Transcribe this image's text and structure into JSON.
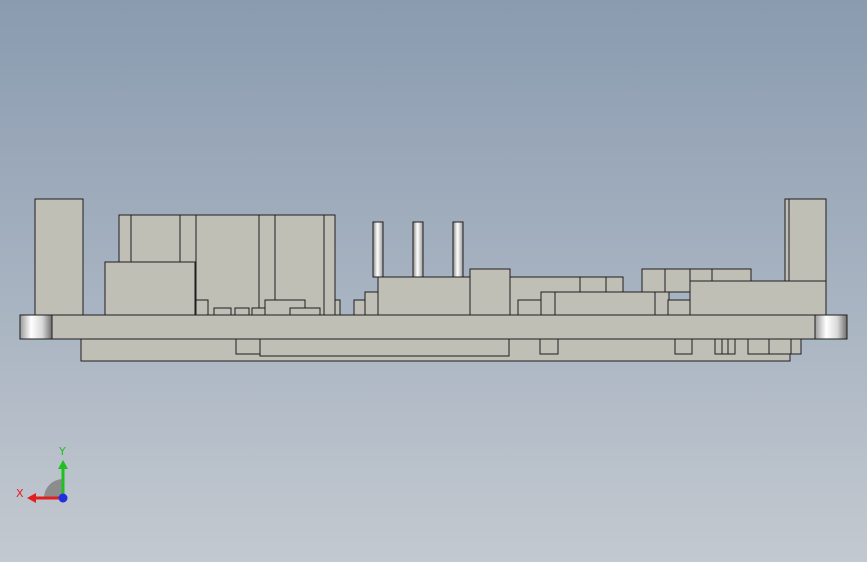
{
  "viewport": {
    "background_top": "#8a9bb0",
    "background_bottom": "#c3c9d0"
  },
  "model": {
    "part_color": "#c0bfb6",
    "edge_color": "#1e1e1e"
  },
  "triad": {
    "x_label": "X",
    "y_label": "Y",
    "x_color": "#e02020",
    "y_color": "#20c020",
    "z_color": "#2030e0"
  }
}
